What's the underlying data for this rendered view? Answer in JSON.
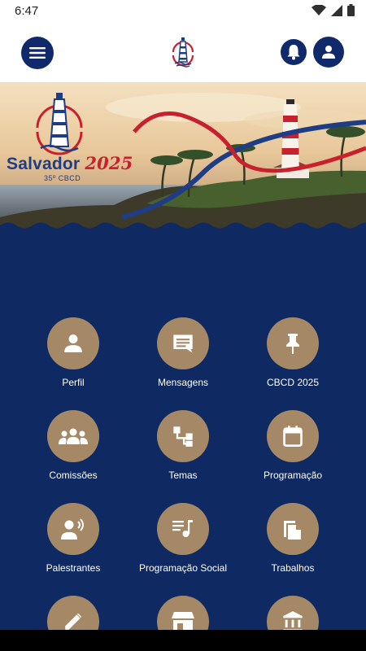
{
  "status_bar": {
    "time": "6:47",
    "icons": [
      "wifi-icon",
      "signal-icon",
      "battery-icon"
    ]
  },
  "app_bar": {
    "icons": [
      "menu-icon",
      "lighthouse-logo",
      "bell-icon",
      "user-icon"
    ]
  },
  "banner": {
    "title": "Salvador",
    "year": "2025",
    "subtitle": "35º CBCD"
  },
  "colors": {
    "navy": "#0f2a62",
    "tile": "#a58866",
    "accent_red": "#c8202c"
  },
  "menu": [
    {
      "label": "Perfil",
      "icon": "person-icon"
    },
    {
      "label": "Mensagens",
      "icon": "message-icon"
    },
    {
      "label": "CBCD 2025",
      "icon": "pin-icon"
    },
    {
      "label": "Comissões",
      "icon": "groups-icon"
    },
    {
      "label": "Temas",
      "icon": "hierarchy-icon"
    },
    {
      "label": "Programação",
      "icon": "calendar-icon"
    },
    {
      "label": "Palestrantes",
      "icon": "speaker-icon"
    },
    {
      "label": "Programação Social",
      "icon": "music-list-icon"
    },
    {
      "label": "Trabalhos",
      "icon": "documents-icon"
    },
    {
      "label": "",
      "icon": "pencil-icon"
    },
    {
      "label": "",
      "icon": "store-icon"
    },
    {
      "label": "",
      "icon": "bank-icon"
    }
  ]
}
